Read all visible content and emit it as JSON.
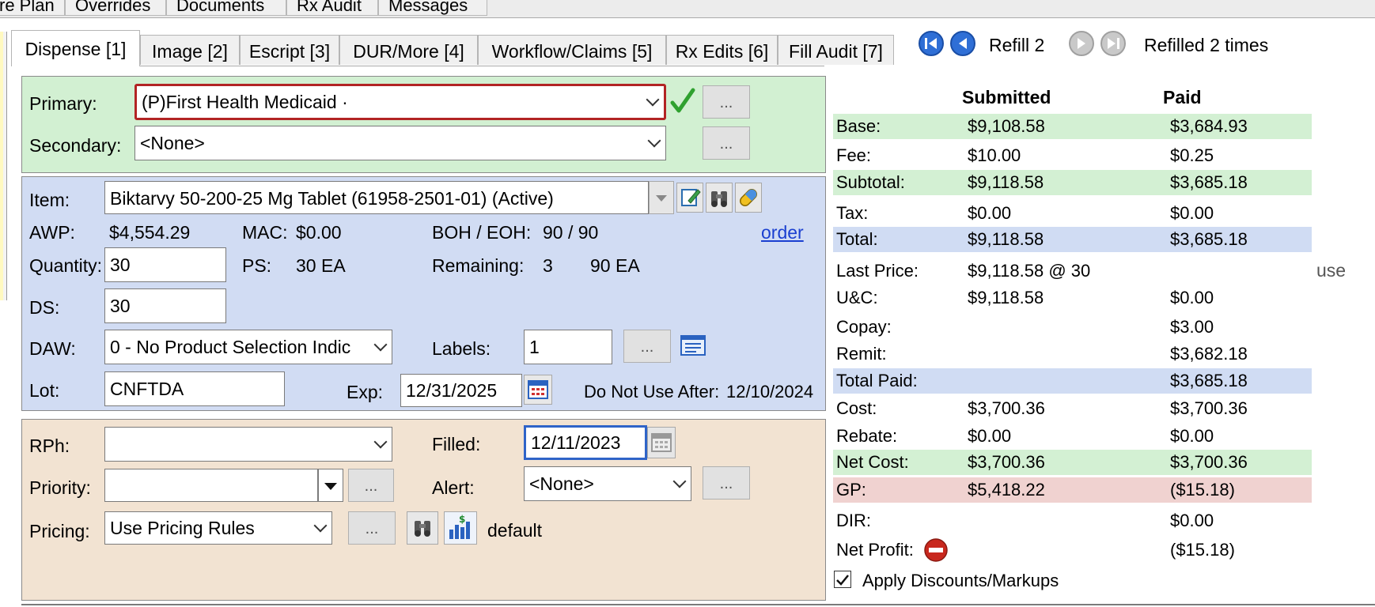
{
  "top_tabs": [
    "re Plan",
    "Overrides",
    "Documents",
    "Rx Audit",
    "Messages"
  ],
  "sub_tabs": [
    {
      "label": "Dispense [1]",
      "active": true
    },
    {
      "label": "Image [2]"
    },
    {
      "label": "Escript [3]"
    },
    {
      "label": "DUR/More [4]"
    },
    {
      "label": "Workflow/Claims [5]"
    },
    {
      "label": "Rx Edits [6]"
    },
    {
      "label": "Fill Audit [7]"
    }
  ],
  "refill": {
    "label": "Refill 2",
    "status": "Refilled 2 times"
  },
  "plans": {
    "primary_label": "Primary:",
    "primary_value": "(P)First Health Medicaid ·",
    "secondary_label": "Secondary:",
    "secondary_value": "<None>",
    "more_button": "..."
  },
  "item": {
    "item_label": "Item:",
    "item_value": "Biktarvy 50-200-25 Mg Tablet (61958-2501-01) (Active)",
    "awp_label": "AWP:",
    "awp_value": "$4,554.29",
    "mac_label": "MAC:",
    "mac_value": "$0.00",
    "boh_label": "BOH / EOH:",
    "boh_value": "90 / 90",
    "order_link": "order",
    "quantity_label": "Quantity:",
    "quantity_value": "30",
    "ps_label": "PS:",
    "ps_value": "30 EA",
    "remaining_label": "Remaining:",
    "remaining_value": "3",
    "remaining_units": "90 EA",
    "ds_label": "DS:",
    "ds_value": "30",
    "daw_label": "DAW:",
    "daw_value": "0 - No Product Selection Indic",
    "labels_label": "Labels:",
    "labels_value": "1",
    "labels_more": "...",
    "lot_label": "Lot:",
    "lot_value": "CNFTDA",
    "exp_label": "Exp:",
    "exp_value": "12/31/2025",
    "dnua_label": "Do Not Use After:",
    "dnua_value": "12/10/2024"
  },
  "fill": {
    "rph_label": "RPh:",
    "rph_value": "",
    "filled_label": "Filled:",
    "filled_value": "12/11/2023",
    "priority_label": "Priority:",
    "priority_value": "",
    "priority_more": "...",
    "alert_label": "Alert:",
    "alert_value": "<None>",
    "alert_more": "...",
    "pricing_label": "Pricing:",
    "pricing_value": "Use Pricing Rules",
    "pricing_more": "...",
    "pricing_mode": "default"
  },
  "financials": {
    "header_submitted": "Submitted",
    "header_paid": "Paid",
    "rows": [
      {
        "label": "Base:",
        "submitted": "$9,108.58",
        "paid": "$3,684.93",
        "band": "green"
      },
      {
        "label": "Fee:",
        "submitted": "$10.00",
        "paid": "$0.25",
        "band": ""
      },
      {
        "label": "Subtotal:",
        "submitted": "$9,118.58",
        "paid": "$3,685.18",
        "band": "green"
      },
      {
        "label": "Tax:",
        "submitted": "$0.00",
        "paid": "$0.00",
        "band": ""
      },
      {
        "label": "Total:",
        "submitted": "$9,118.58",
        "paid": "$3,685.18",
        "band": "blue"
      },
      {
        "label": "Last Price:",
        "submitted": "$9,118.58 @ 30",
        "paid": "",
        "band": ""
      },
      {
        "label": "U&C:",
        "submitted": "$9,118.58",
        "paid": "$0.00",
        "band": ""
      },
      {
        "label": "Copay:",
        "submitted": "",
        "paid": "$3.00",
        "band": ""
      },
      {
        "label": "Remit:",
        "submitted": "",
        "paid": "$3,682.18",
        "band": ""
      },
      {
        "label": "Total Paid:",
        "submitted": "",
        "paid": "$3,685.18",
        "band": "blue"
      },
      {
        "label": "Cost:",
        "submitted": "$3,700.36",
        "paid": "$3,700.36",
        "band": ""
      },
      {
        "label": "Rebate:",
        "submitted": "$0.00",
        "paid": "$0.00",
        "band": ""
      },
      {
        "label": "Net Cost:",
        "submitted": "$3,700.36",
        "paid": "$3,700.36",
        "band": "green"
      },
      {
        "label": "GP:",
        "submitted": "$5,418.22",
        "paid": "($15.18)",
        "band": "red"
      },
      {
        "label": "DIR:",
        "submitted": "",
        "paid": "$0.00",
        "band": ""
      },
      {
        "label": "Net Profit:",
        "submitted": "",
        "paid": "($15.18)",
        "band": ""
      }
    ],
    "use_link": "use",
    "apply_discounts_label": "Apply Discounts/Markups",
    "apply_discounts_checked": true
  }
}
